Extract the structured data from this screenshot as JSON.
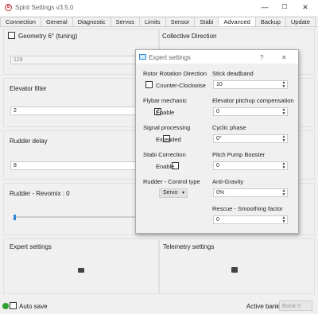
{
  "window": {
    "title": "Spirit Settings v3.5.0",
    "minimize": "—",
    "maximize": "☐",
    "close": "✕"
  },
  "tabs": [
    "Connection",
    "General",
    "Diagnostic",
    "Servos",
    "Limits",
    "Sensor",
    "Stabi",
    "Advanced",
    "Backup",
    "Update"
  ],
  "active_tab": "Advanced",
  "main": {
    "geometry_label": "Geometry 6° (tuning)",
    "geometry_value": "128",
    "collective_direction_label": "Collective Direction",
    "elevator_filter_label": "Elevator filter",
    "elevator_filter_value": "2",
    "rudder_delay_label": "Rudder delay",
    "rudder_delay_value": "8",
    "rudder_revomix_label": "Rudder - Revomix : 0",
    "rudder_revomix_level": 0,
    "expert_settings_label": "Expert settings",
    "telemetry_settings_label": "Telemetry settings"
  },
  "dialog": {
    "title": "Expert settings",
    "help": "?",
    "close": "✕",
    "rotor_rotation_direction_label": "Rotor Rotation Direction",
    "counter_clockwise_label": "Counter-Clockwise",
    "counter_clockwise_checked": false,
    "stick_deadband_label": "Stick deadband",
    "stick_deadband_value": "10",
    "flybar_mechanic_label": "Flybar mechanic",
    "flybar_enable_label": "Enable",
    "flybar_enable_checked": true,
    "elevator_pitchup_label": "Elevator pitchup compensation",
    "elevator_pitchup_value": "0",
    "signal_processing_label": "Signal processing",
    "extended_label": "Extended",
    "extended_checked": false,
    "cyclic_phase_label": "Cyclic phase",
    "cyclic_phase_value": "0°",
    "stabi_correction_label": "Stabi Correction",
    "stabi_enable_label": "Enable",
    "stabi_enable_checked": false,
    "pitch_pump_booster_label": "Pitch Pump Booster",
    "pitch_pump_booster_value": "0",
    "rudder_control_type_label": "Rudder - Control type",
    "rudder_control_type_value": "Servo",
    "anti_gravity_label": "Anti-Gravity",
    "anti_gravity_value": "0%",
    "rescue_smoothing_label": "Rescue - Smoothing factor",
    "rescue_smoothing_value": "0"
  },
  "status": {
    "auto_save_label": "Auto save",
    "active_bank_label": "Active bank:",
    "active_bank_value": "Bank 0"
  },
  "colors": {
    "accent": "#2f87d6",
    "logo": "#c0262d",
    "status_led": "#2ca02c"
  }
}
